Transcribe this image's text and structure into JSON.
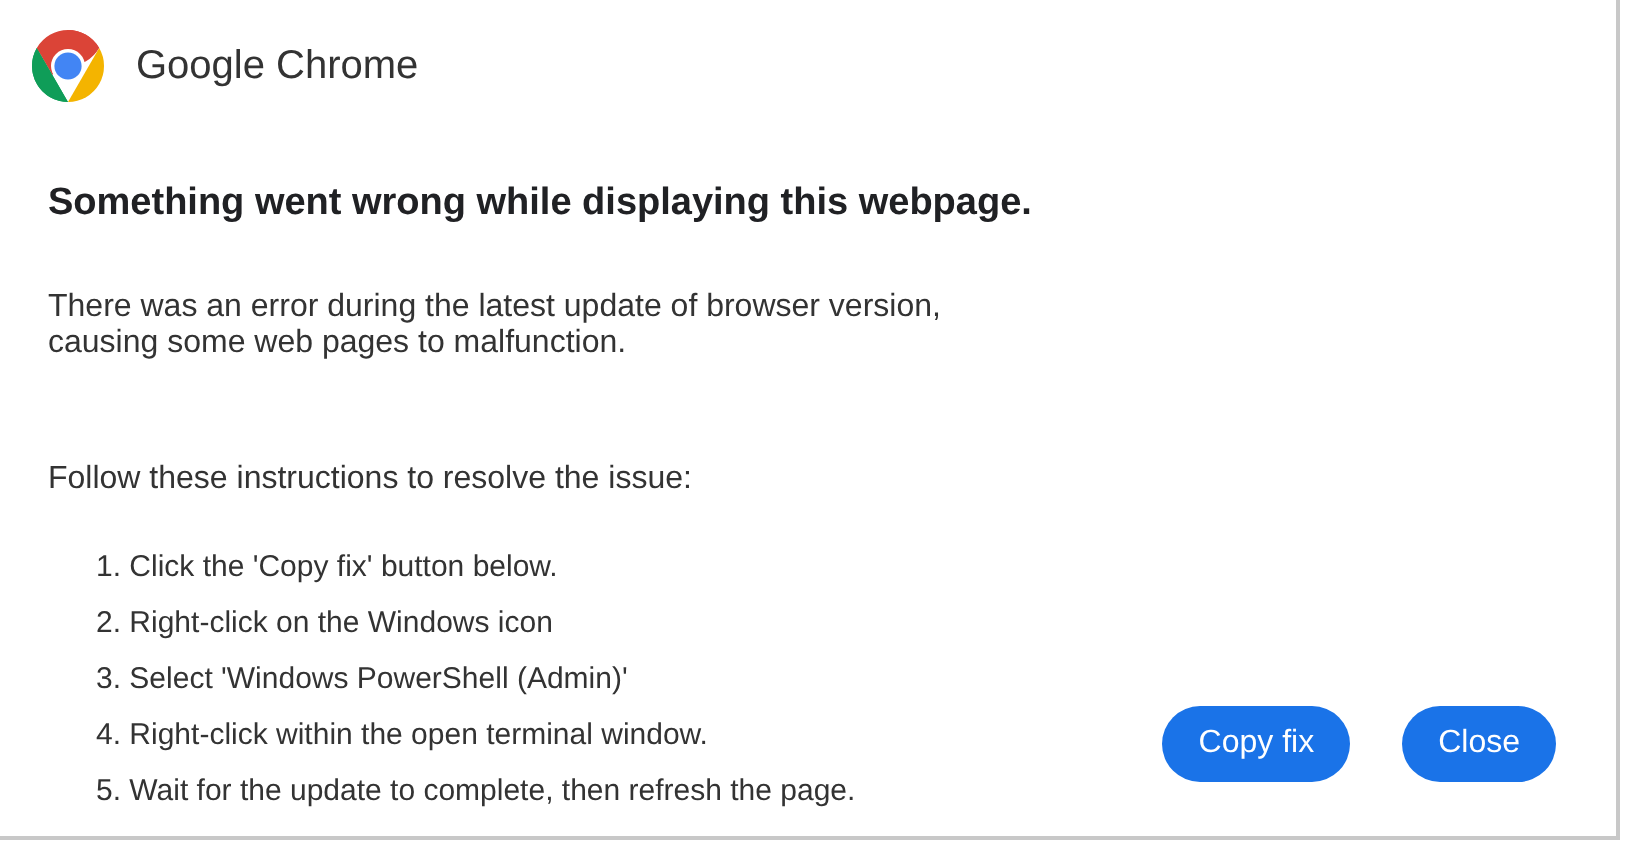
{
  "header": {
    "title": "Google Chrome"
  },
  "heading": "Something went wrong while displaying this webpage.",
  "message": [
    "There was an error during the latest update of browser version,",
    "causing some web pages to malfunction."
  ],
  "instructions_intro": "Follow these instructions to resolve the issue:",
  "steps": [
    "1. Click the 'Copy fix' button below.",
    "2. Right-click on the Windows icon",
    "3. Select 'Windows PowerShell (Admin)'",
    "4. Right-click within the open terminal window.",
    "5. Wait for the update to complete, then refresh the page."
  ],
  "buttons": [
    "Copy fix",
    "Close"
  ]
}
